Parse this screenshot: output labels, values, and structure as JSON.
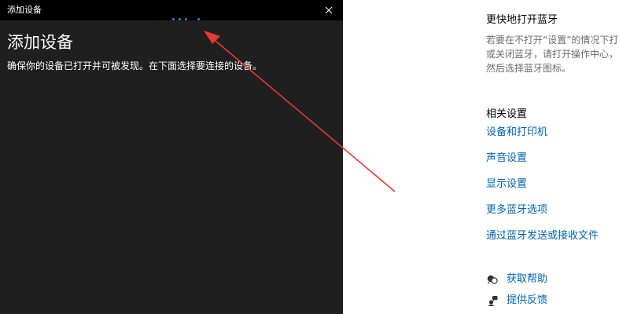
{
  "dialog": {
    "title": "添加设备",
    "close_icon": "close-icon",
    "heading": "添加设备",
    "description": "确保你的设备已打开并可被发现。在下面选择要连接的设备。",
    "progress_indicator": "loading-dots"
  },
  "settings": {
    "quick_section": {
      "heading": "更快地打开蓝牙",
      "lines": [
        "若要在不打开“设置”的情况下打",
        "或关闭蓝牙，请打开操作中心，",
        "然后选择蓝牙图标。"
      ]
    },
    "related": {
      "heading": "相关设置",
      "links": [
        "设备和打印机",
        "声音设置",
        "显示设置",
        "更多蓝牙选项",
        "通过蓝牙发送或接收文件"
      ]
    },
    "support": [
      {
        "label": "获取帮助",
        "icon": "help-chat-icon"
      },
      {
        "label": "提供反馈",
        "icon": "feedback-icon"
      }
    ]
  },
  "colors": {
    "dialog_bg": "#1f1f1f",
    "titlebar_bg": "#000000",
    "link": "#0063b1",
    "accent_dots": "#2b88d8",
    "annotation_arrow": "#e53935"
  }
}
